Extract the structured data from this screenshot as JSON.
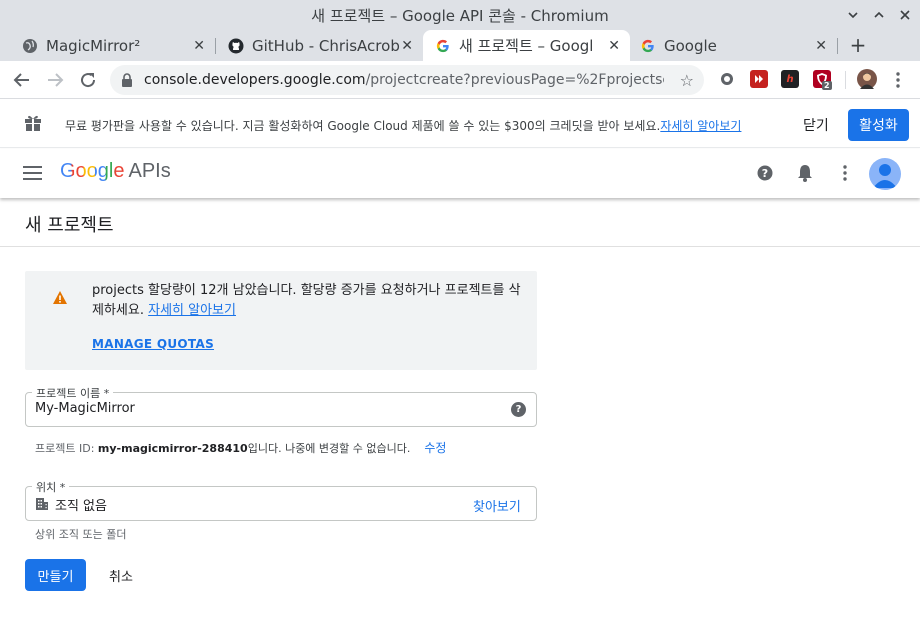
{
  "window": {
    "title": "새 프로젝트 – Google API 콘솔 - Chromium"
  },
  "tabs": [
    {
      "label": "MagicMirror²",
      "icon": "globe-icon"
    },
    {
      "label": "GitHub - ChrisAcrob",
      "icon": "github-icon"
    },
    {
      "label": "새 프로젝트 – Googl",
      "icon": "google-g-icon",
      "active": true
    },
    {
      "label": "Google",
      "icon": "google-g-icon"
    }
  ],
  "toolbar": {
    "url_host": "console.developers.google.com",
    "url_path": "/projectcreate?previousPage=%2Fprojectselector2...",
    "extension_badge": "2"
  },
  "banner": {
    "text": "무료 평가판을 사용할 수 있습니다. 지금 활성화하여 Google Cloud 제품에 쓸 수 있는 $300의 크레딧을 받아 보세요.",
    "link": "자세히 알아보기",
    "dismiss": "닫기",
    "activate": "활성화"
  },
  "appbar": {
    "logo_google": "Google",
    "logo_apis": "APIs"
  },
  "page": {
    "title": "새 프로젝트",
    "notice": {
      "text": "projects 할당량이 12개 남았습니다. 할당량 증가를 요청하거나 프로젝트를 삭제하세요.",
      "link": "자세히 알아보기",
      "manage": "MANAGE QUOTAS"
    },
    "project_name": {
      "label": "프로젝트 이름 *",
      "value": "My-MagicMirror"
    },
    "project_id_hint": {
      "prefix": "프로젝트 ID: ",
      "id": "my-magicmirror-288410",
      "suffix": "입니다. 나중에 변경할 수 없습니다.",
      "edit": "수정"
    },
    "location": {
      "label": "위치 *",
      "value": "조직 없음",
      "browse": "찾아보기",
      "hint": "상위 조직 또는 폴더"
    },
    "create": "만들기",
    "cancel": "취소"
  }
}
